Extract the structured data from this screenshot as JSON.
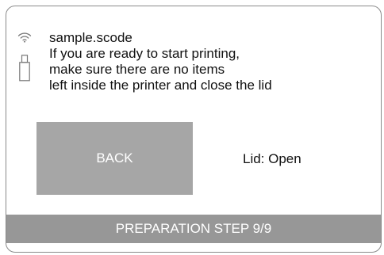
{
  "status_icons": {
    "wifi": "wifi-icon",
    "usb": "usb-drive-icon"
  },
  "message": {
    "filename": "sample.scode",
    "lines": [
      "If you are ready to start printing,",
      "make sure there are no items",
      "left inside the printer and close the lid"
    ]
  },
  "buttons": {
    "back_label": "BACK"
  },
  "lid": {
    "status_text": "Lid: Open"
  },
  "footer": {
    "step_text": "PREPARATION STEP 9/9"
  },
  "colors": {
    "button_bg": "#a6a6a6",
    "footer_bg": "#979797",
    "text": "#111111"
  }
}
